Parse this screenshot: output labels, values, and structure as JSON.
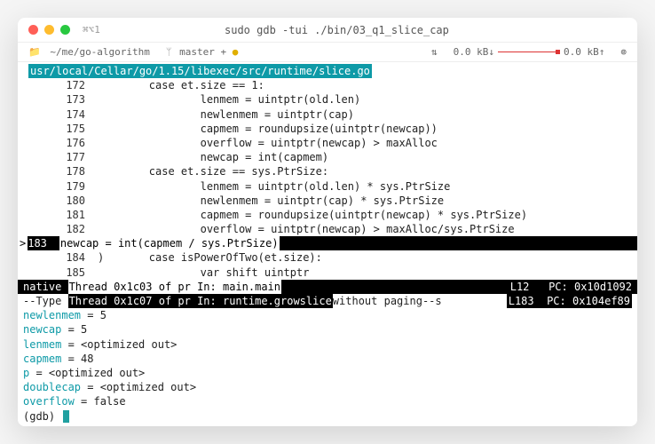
{
  "titlebar": {
    "shortcut": "⌘⌥1",
    "title": "sudo gdb -tui ./bin/03_q1_slice_cap"
  },
  "toolbar": {
    "path": "~/me/go-algorithm",
    "branch": "master + ",
    "branch_dot": "●",
    "sync": "⇅",
    "down": "0.0 kB↓",
    "up": "0.0 kB↑",
    "gear": "⊚"
  },
  "source": {
    "path": "usr/local/Cellar/go/1.15/libexec/src/runtime/slice.go",
    "lines": [
      {
        "n": "172",
        "c": "        case et.size == 1:"
      },
      {
        "n": "173",
        "c": "                lenmem = uintptr(old.len)"
      },
      {
        "n": "174",
        "c": "                newlenmem = uintptr(cap)"
      },
      {
        "n": "175",
        "c": "                capmem = roundupsize(uintptr(newcap))"
      },
      {
        "n": "176",
        "c": "                overflow = uintptr(newcap) > maxAlloc"
      },
      {
        "n": "177",
        "c": "                newcap = int(capmem)"
      },
      {
        "n": "178",
        "c": "        case et.size == sys.PtrSize:"
      },
      {
        "n": "179",
        "c": "                lenmem = uintptr(old.len) * sys.PtrSize"
      },
      {
        "n": "180",
        "c": "                newlenmem = uintptr(cap) * sys.PtrSize"
      },
      {
        "n": "181",
        "c": "                capmem = roundupsize(uintptr(newcap) * sys.PtrSize)"
      },
      {
        "n": "182",
        "c": "                overflow = uintptr(newcap) > maxAlloc/sys.PtrSize"
      }
    ],
    "current": {
      "marker": ">",
      "n": "183",
      "pad": "                ",
      "c": "newcap = int(capmem / sys.PtrSize)"
    },
    "after": [
      {
        "n": "184",
        "c": ")       case isPowerOfTwo(et.size):"
      },
      {
        "n": "185",
        "c": "                var shift uintptr"
      }
    ]
  },
  "status": {
    "row1": {
      "l": "native ",
      "m": "Thread 0x1c03 of pr In: main.main",
      "r": "L12   PC: 0x10d1092"
    },
    "row2": {
      "l": "--Type ",
      "m": "Thread 0x1c07 of pr In: runtime.growslice",
      "tail": "without paging--s",
      "r": "L183  PC: 0x104ef89"
    }
  },
  "vars": [
    {
      "name": "newlenmem",
      "val": " = 5"
    },
    {
      "name": "newcap",
      "val": " = 5"
    },
    {
      "name": "lenmem",
      "val": " = <optimized out>"
    },
    {
      "name": "capmem",
      "val": " = 48"
    },
    {
      "name": "p",
      "val": " = <optimized out>"
    },
    {
      "name": "doublecap",
      "val": " = <optimized out>"
    },
    {
      "name": "overflow",
      "val": " = false"
    }
  ],
  "prompt": "(gdb) "
}
